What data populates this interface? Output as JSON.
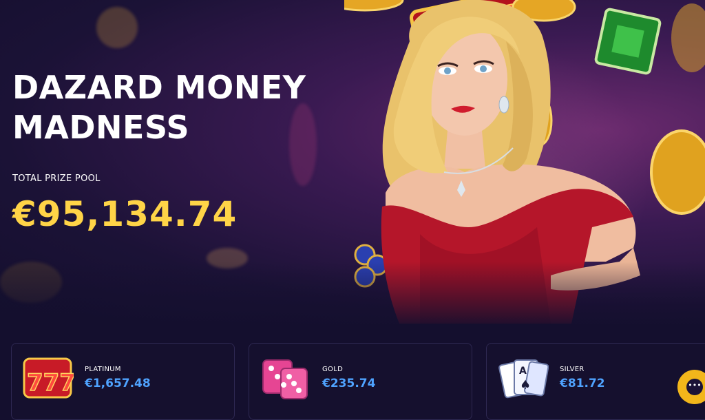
{
  "hero": {
    "title": "DAZARD MONEY MADNESS",
    "prize_label": "TOTAL PRIZE POOL",
    "prize_value": "€95,134.74"
  },
  "tiers": [
    {
      "name": "PLATINUM",
      "amount": "€1,657.48",
      "icon": "slot-777-icon"
    },
    {
      "name": "GOLD",
      "amount": "€235.74",
      "icon": "pink-dice-icon"
    },
    {
      "name": "SILVER",
      "amount": "€81.72",
      "icon": "playing-cards-icon"
    }
  ],
  "chat": {
    "icon": "chat-bubble-icon"
  },
  "colors": {
    "background": "#140f2e",
    "prize_gold": "#ffd447",
    "tier_amount_blue": "#4fa3ff",
    "chat_button": "#f2b61b",
    "card_border": "#2e2852"
  }
}
